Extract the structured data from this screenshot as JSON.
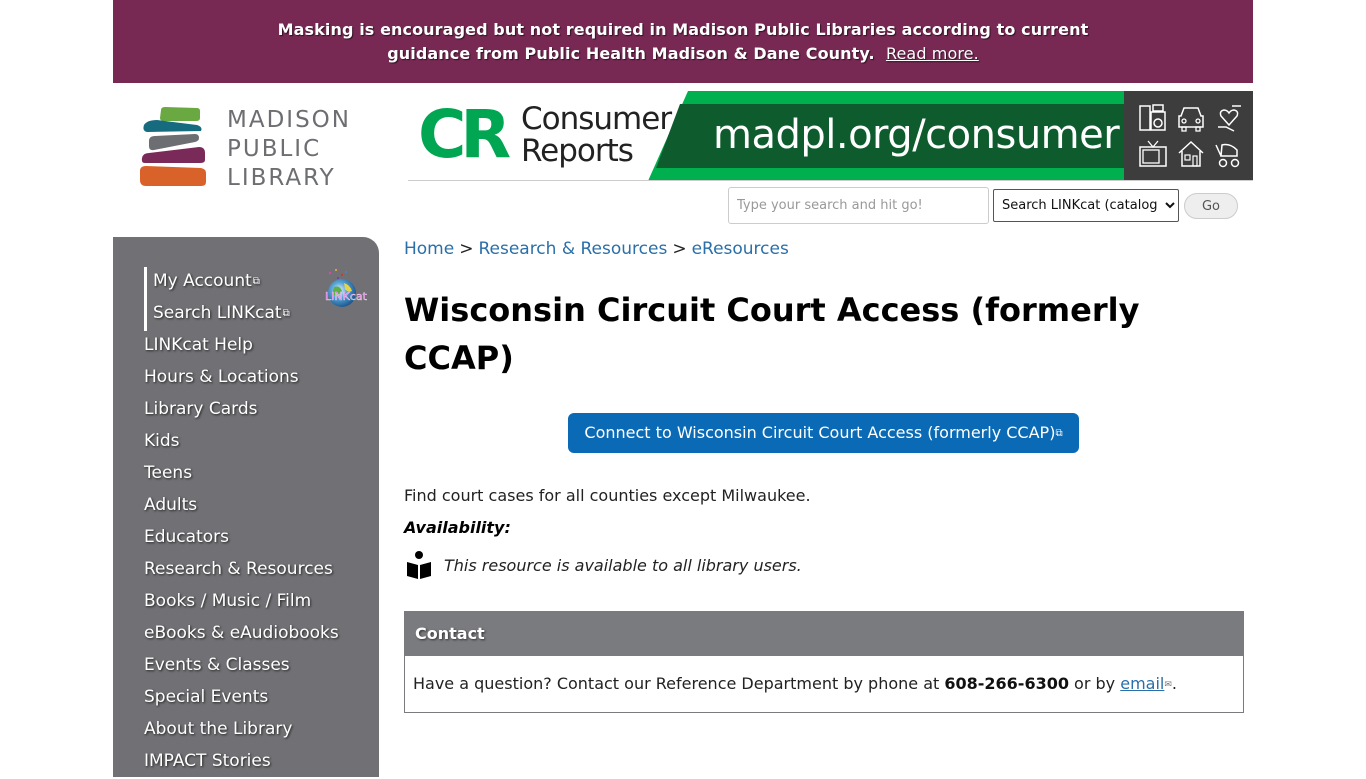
{
  "alert": {
    "line1": "Masking is encouraged but not required in Madison Public Libraries according to current",
    "line2": "guidance from Public Health Madison & Dane County.",
    "link_label": "Read more."
  },
  "logo": {
    "line1": "MADISON",
    "line2": "PUBLIC",
    "line3": "LIBRARY",
    "bar_colors": [
      "#6aa842",
      "#176b7f",
      "#6d6e71",
      "#7a2a59",
      "#d9622b"
    ]
  },
  "ad": {
    "brand_letters": "CR",
    "brand_line1": "Consumer",
    "brand_line2": "Reports",
    "url": "madpl.org/consumer",
    "icons": [
      "appliances-icon",
      "car-icon",
      "heart-hand-icon",
      "tv-icon",
      "house-icon",
      "stroller-icon"
    ],
    "colors": {
      "light_green": "#00b04f",
      "dark_green": "#0e5c2e",
      "gray": "#3d3d3d"
    }
  },
  "search": {
    "placeholder": "Type your search and hit go!",
    "value": "",
    "scope_selected": "Search LINKcat (catalog)",
    "go_label": "Go"
  },
  "sidebar": {
    "items": [
      {
        "label": "My Account",
        "external": true
      },
      {
        "label": "Search LINKcat",
        "external": true
      },
      {
        "label": "LINKcat Help"
      },
      {
        "label": "Hours & Locations"
      },
      {
        "label": "Library Cards"
      },
      {
        "label": "Kids"
      },
      {
        "label": "Teens"
      },
      {
        "label": "Adults"
      },
      {
        "label": "Educators"
      },
      {
        "label": "Research & Resources"
      },
      {
        "label": "Books / Music / Film"
      },
      {
        "label": "eBooks & eAudiobooks"
      },
      {
        "label": "Events & Classes"
      },
      {
        "label": "Special Events"
      },
      {
        "label": "About the Library"
      },
      {
        "label": "IMPACT Stories"
      }
    ],
    "linkcat_logo_text": "LINKcat",
    "background": "#717175"
  },
  "breadcrumb": {
    "items": [
      "Home",
      "Research & Resources",
      "eResources"
    ],
    "separator": ">"
  },
  "page": {
    "title": "Wisconsin Circuit Court Access (formerly CCAP)",
    "connect_label": "Connect to Wisconsin Circuit Court Access (formerly CCAP)",
    "description": "Find court cases for all counties except Milwaukee.",
    "availability_label": "Availability:",
    "availability_text": "This resource is available to all library users.",
    "button_color": "#0a6ab5"
  },
  "contact": {
    "heading": "Contact",
    "text_before": "Have a question? Contact our Reference Department by phone at ",
    "phone": "608-266-6300",
    "text_middle": " or by ",
    "email_label": "email",
    "text_after": "."
  },
  "icons": {
    "external_link": "⧉",
    "mail": "✉"
  }
}
